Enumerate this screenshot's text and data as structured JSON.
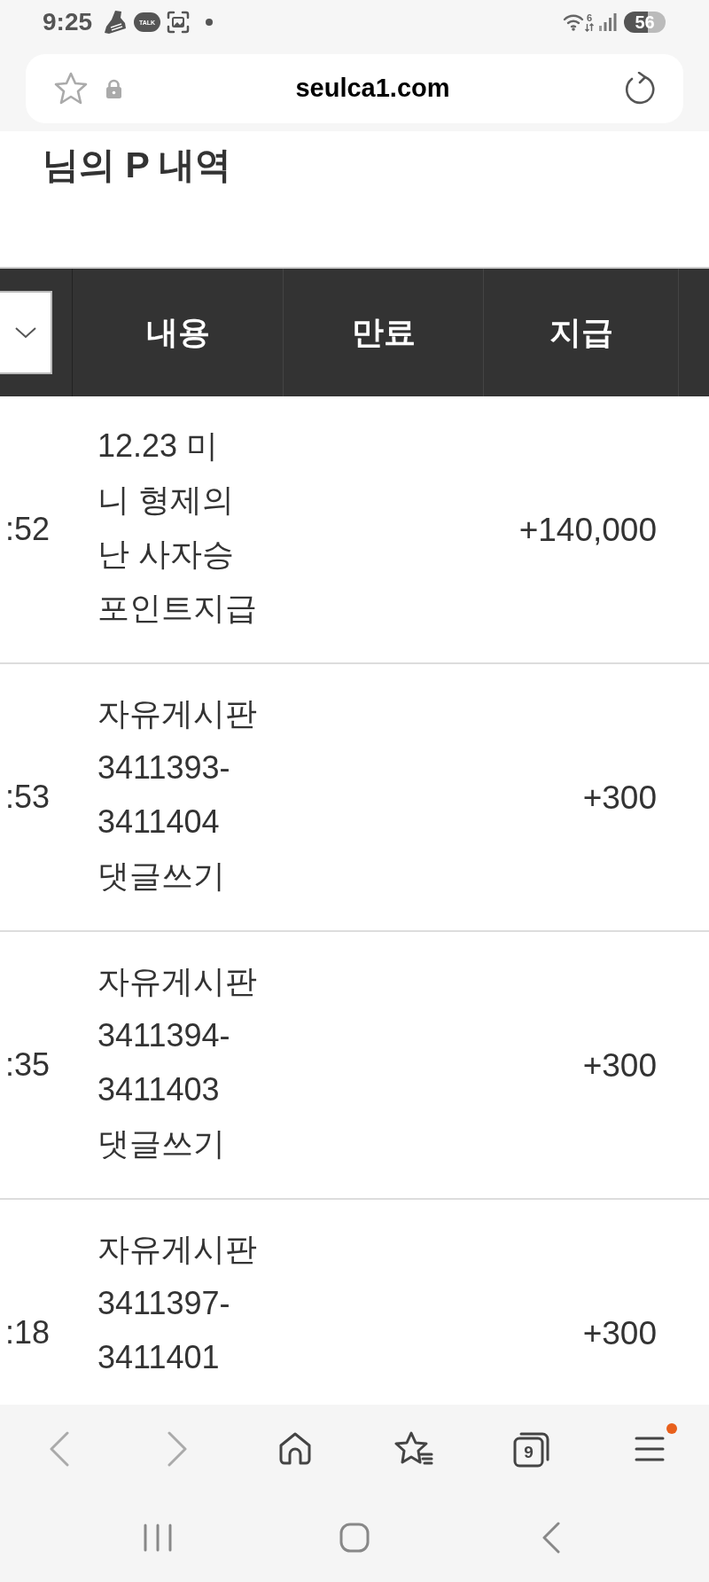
{
  "status_bar": {
    "time": "9:25",
    "chat_badge": "TALK",
    "wifi_label": "6",
    "battery": "56"
  },
  "address_bar": {
    "url": "seulca1.com"
  },
  "page": {
    "title": "님의 P 내역"
  },
  "table": {
    "columns": [
      {
        "label": "내용"
      },
      {
        "label": "만료"
      },
      {
        "label": "지급"
      }
    ],
    "rows": [
      {
        "column_1": ":52",
        "content": "12.23 미\n니 형제의\n난 사자승\n포인트지급",
        "paid": "+140,000"
      },
      {
        "column_1": ":53",
        "content": "자유게시판\n3411393-\n3411404\n댓글쓰기",
        "paid": "+300"
      },
      {
        "column_1": ":35",
        "content": "자유게시판\n3411394-\n3411403\n댓글쓰기",
        "paid": "+300"
      },
      {
        "column_1": ":18",
        "content": "자유게시판\n3411397-\n3411401",
        "paid": "+300"
      }
    ]
  },
  "bottom_nav": {
    "tab_count": "9",
    "items": [
      {
        "kind": "back",
        "disabled": true,
        "notification": false
      },
      {
        "kind": "forward",
        "disabled": true,
        "notification": false
      },
      {
        "kind": "home",
        "disabled": false,
        "notification": false
      },
      {
        "kind": "bookmarks",
        "disabled": false,
        "notification": false
      },
      {
        "kind": "tabs",
        "disabled": false,
        "notification": false
      },
      {
        "kind": "menu",
        "disabled": false,
        "notification": true
      }
    ]
  },
  "system_nav": {
    "items": [
      {
        "kind": "recents"
      },
      {
        "kind": "home"
      },
      {
        "kind": "back"
      }
    ]
  }
}
